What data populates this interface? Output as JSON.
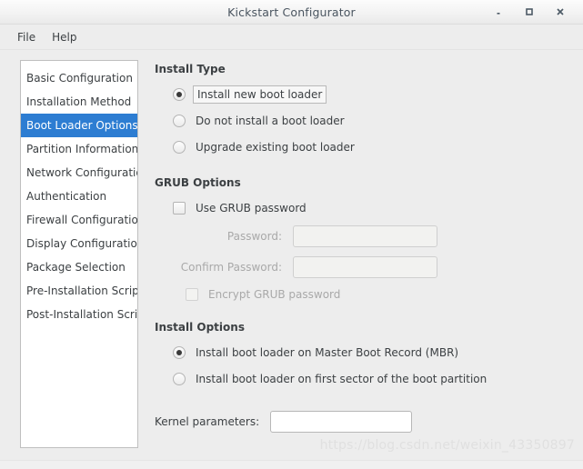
{
  "window": {
    "title": "Kickstart Configurator",
    "buttons": [
      {
        "name": "minimize",
        "glyph": "minimize-icon"
      },
      {
        "name": "maximize",
        "glyph": "maximize-icon"
      },
      {
        "name": "close",
        "glyph": "close-icon"
      }
    ]
  },
  "menubar": {
    "items": [
      {
        "label": "File"
      },
      {
        "label": "Help"
      }
    ]
  },
  "sidebar": {
    "selected_index": 2,
    "items": [
      {
        "label": "Basic Configuration"
      },
      {
        "label": "Installation Method"
      },
      {
        "label": "Boot Loader Options"
      },
      {
        "label": "Partition Information"
      },
      {
        "label": "Network Configuration"
      },
      {
        "label": "Authentication"
      },
      {
        "label": "Firewall Configuration"
      },
      {
        "label": "Display Configuration"
      },
      {
        "label": "Package Selection"
      },
      {
        "label": "Pre-Installation Script"
      },
      {
        "label": "Post-Installation Script"
      }
    ]
  },
  "install_type": {
    "title": "Install Type",
    "options": [
      {
        "label": "Install new boot loader",
        "checked": true,
        "focused": true
      },
      {
        "label": "Do not install a boot loader",
        "checked": false,
        "focused": false
      },
      {
        "label": "Upgrade existing boot loader",
        "checked": false,
        "focused": false
      }
    ]
  },
  "grub_options": {
    "title": "GRUB Options",
    "use_grub_password": {
      "label": "Use GRUB password",
      "checked": false,
      "disabled": false
    },
    "password": {
      "label": "Password:",
      "value": "",
      "placeholder": "",
      "disabled": true
    },
    "confirm_password": {
      "label": "Confirm Password:",
      "value": "",
      "placeholder": "",
      "disabled": true
    },
    "encrypt": {
      "label": "Encrypt GRUB password",
      "checked": false,
      "disabled": true
    }
  },
  "install_options": {
    "title": "Install Options",
    "options": [
      {
        "label": "Install boot loader on Master Boot Record (MBR)",
        "checked": true
      },
      {
        "label": "Install boot loader on first sector of the boot partition",
        "checked": false
      }
    ],
    "kernel": {
      "label": "Kernel parameters:",
      "value": "",
      "placeholder": ""
    }
  },
  "watermark": {
    "text": "https://blog.csdn.net/weixin_43350897"
  },
  "colors": {
    "accent": "#2d7dd2",
    "window_bg": "#ededed",
    "panel_bg": "#ffffff",
    "text": "#3c4043",
    "disabled_text": "#a9a9a9"
  }
}
